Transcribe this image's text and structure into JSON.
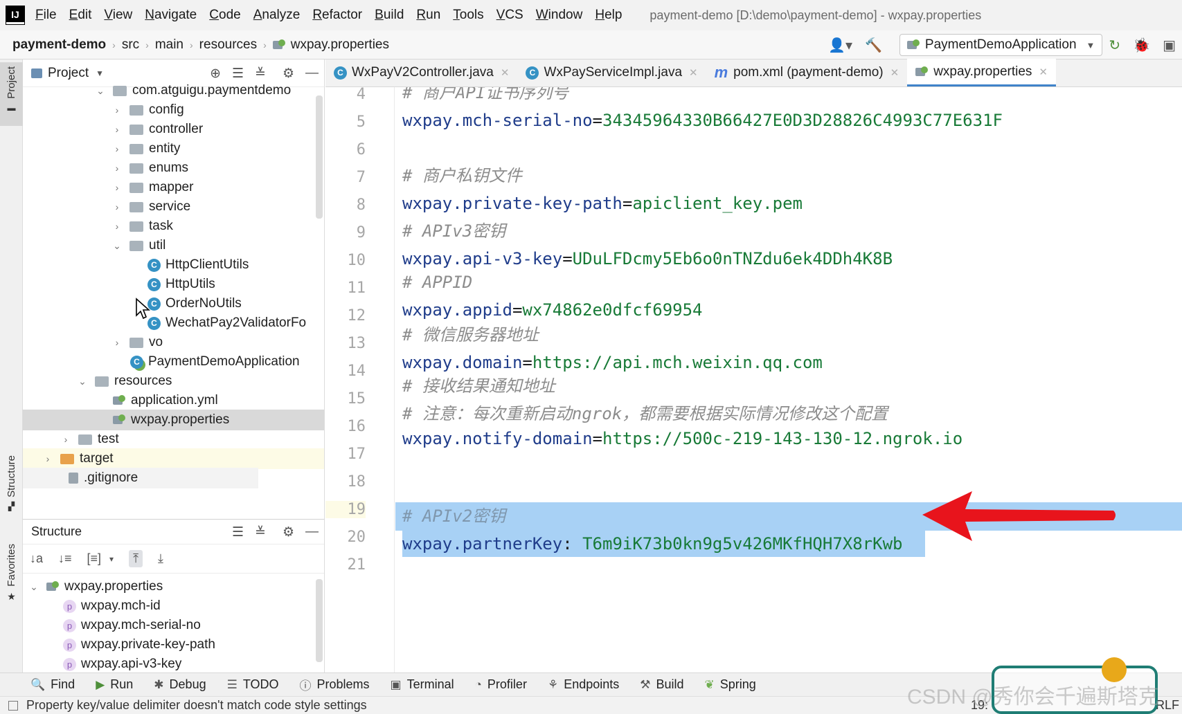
{
  "menubar": {
    "logo": "IJ",
    "items": [
      "File",
      "Edit",
      "View",
      "Navigate",
      "Code",
      "Analyze",
      "Refactor",
      "Build",
      "Run",
      "Tools",
      "VCS",
      "Window",
      "Help"
    ],
    "window_title": "payment-demo [D:\\demo\\payment-demo] - wxpay.properties"
  },
  "breadcrumb": {
    "project": "payment-demo",
    "parts": [
      "src",
      "main",
      "resources"
    ],
    "file": "wxpay.properties"
  },
  "run_config": {
    "label": "PaymentDemoApplication"
  },
  "left_stripe": {
    "project": "Project",
    "structure": "Structure",
    "favorites": "Favorites"
  },
  "project_panel": {
    "title": "Project",
    "tree": [
      {
        "label": "com.atguigu.paymentdemo",
        "type": "package",
        "expanded": true
      },
      {
        "label": "config",
        "type": "folder"
      },
      {
        "label": "controller",
        "type": "folder"
      },
      {
        "label": "entity",
        "type": "folder"
      },
      {
        "label": "enums",
        "type": "folder"
      },
      {
        "label": "mapper",
        "type": "folder"
      },
      {
        "label": "service",
        "type": "folder"
      },
      {
        "label": "task",
        "type": "folder"
      },
      {
        "label": "util",
        "type": "folder",
        "expanded": true
      },
      {
        "label": "HttpClientUtils",
        "type": "class"
      },
      {
        "label": "HttpUtils",
        "type": "class"
      },
      {
        "label": "OrderNoUtils",
        "type": "class"
      },
      {
        "label": "WechatPay2ValidatorFo",
        "type": "class"
      },
      {
        "label": "vo",
        "type": "folder"
      },
      {
        "label": "PaymentDemoApplication",
        "type": "spring-class"
      },
      {
        "label": "resources",
        "type": "resources",
        "expanded": true
      },
      {
        "label": "application.yml",
        "type": "props"
      },
      {
        "label": "wxpay.properties",
        "type": "props",
        "selected": true
      },
      {
        "label": "test",
        "type": "folder"
      },
      {
        "label": "target",
        "type": "folder-excluded"
      },
      {
        "label": ".gitignore",
        "type": "file"
      }
    ]
  },
  "structure_panel": {
    "title": "Structure",
    "root": "wxpay.properties",
    "items": [
      "wxpay.mch-id",
      "wxpay.mch-serial-no",
      "wxpay.private-key-path",
      "wxpay.api-v3-key"
    ]
  },
  "editor_tabs": [
    {
      "label": "WxPayV2Controller.java",
      "icon": "class-icon"
    },
    {
      "label": "WxPayServiceImpl.java",
      "icon": "class-icon"
    },
    {
      "label": "pom.xml (payment-demo)",
      "icon": "maven-icon"
    },
    {
      "label": "wxpay.properties",
      "icon": "properties-icon",
      "active": true
    }
  ],
  "editor": {
    "lines": [
      {
        "n": "4",
        "comment": "# 商户API证书序列号"
      },
      {
        "n": "5",
        "key": "wxpay.mch-serial-no",
        "sep": "=",
        "value": "34345964330B66427E0D3D28826C4993C77E631F"
      },
      {
        "n": "6"
      },
      {
        "n": "7",
        "comment": "# 商户私钥文件"
      },
      {
        "n": "8",
        "key": "wxpay.private-key-path",
        "sep": "=",
        "value": "apiclient_key.pem"
      },
      {
        "n": "9",
        "comment": "# APIv3密钥"
      },
      {
        "n": "10",
        "key": "wxpay.api-v3-key",
        "sep": "=",
        "value": "UDuLFDcmy5Eb6o0nTNZdu6ek4DDh4K8B"
      },
      {
        "n": "11",
        "comment": "# APPID"
      },
      {
        "n": "12",
        "key": "wxpay.appid",
        "sep": "=",
        "value": "wx74862e0dfcf69954"
      },
      {
        "n": "13",
        "comment": "# 微信服务器地址"
      },
      {
        "n": "14",
        "key": "wxpay.domain",
        "sep": "=",
        "value": "https://api.mch.weixin.qq.com"
      },
      {
        "n": "15",
        "comment": "# 接收结果通知地址"
      },
      {
        "n": "16",
        "comment": "# 注意：每次重新启动ngrok，都需要根据实际情况修改这个配置"
      },
      {
        "n": "17",
        "key": "wxpay.notify-domain",
        "sep": "=",
        "value": "https://500c-219-143-130-12.ngrok.io"
      },
      {
        "n": "18"
      },
      {
        "n": "19",
        "comment": "# APIv2密钥"
      },
      {
        "n": "20",
        "key": "wxpay.partnerKey",
        "sep": ": ",
        "value": "T6m9iK73b0kn9g5v426MKfHQH7X8rKwb"
      },
      {
        "n": "21"
      }
    ]
  },
  "bottom_tools": [
    "Find",
    "Run",
    "Debug",
    "TODO",
    "Problems",
    "Terminal",
    "Profiler",
    "Endpoints",
    "Build",
    "Spring"
  ],
  "status_bar": {
    "message": "Property key/value delimiter doesn't match code style settings",
    "position": "19:",
    "line_sep": "RLF"
  },
  "watermark": "CSDN @秀你会千遍斯塔克",
  "colors": {
    "selection": "#a8d1f5",
    "arrow": "#e8141c",
    "active_tab_underline": "#4083c9"
  }
}
